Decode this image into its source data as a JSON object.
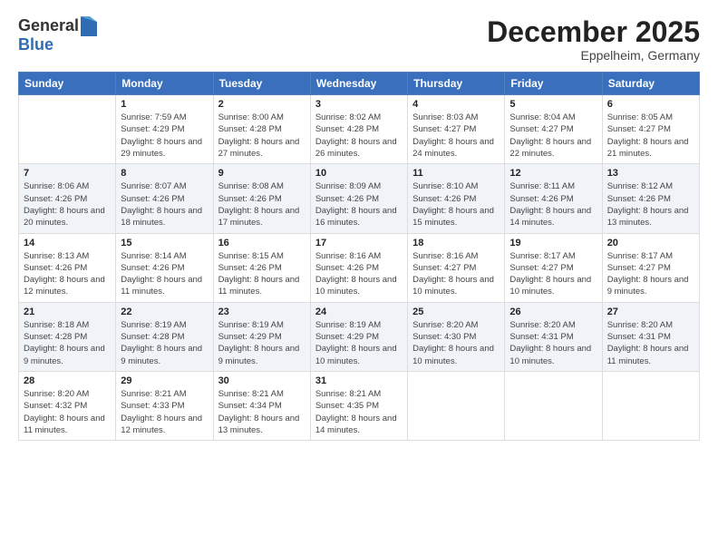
{
  "logo": {
    "general": "General",
    "blue": "Blue"
  },
  "header": {
    "month": "December 2025",
    "location": "Eppelheim, Germany"
  },
  "weekdays": [
    "Sunday",
    "Monday",
    "Tuesday",
    "Wednesday",
    "Thursday",
    "Friday",
    "Saturday"
  ],
  "weeks": [
    [
      {
        "day": "",
        "sunrise": "",
        "sunset": "",
        "daylight": ""
      },
      {
        "day": "1",
        "sunrise": "Sunrise: 7:59 AM",
        "sunset": "Sunset: 4:29 PM",
        "daylight": "Daylight: 8 hours and 29 minutes."
      },
      {
        "day": "2",
        "sunrise": "Sunrise: 8:00 AM",
        "sunset": "Sunset: 4:28 PM",
        "daylight": "Daylight: 8 hours and 27 minutes."
      },
      {
        "day": "3",
        "sunrise": "Sunrise: 8:02 AM",
        "sunset": "Sunset: 4:28 PM",
        "daylight": "Daylight: 8 hours and 26 minutes."
      },
      {
        "day": "4",
        "sunrise": "Sunrise: 8:03 AM",
        "sunset": "Sunset: 4:27 PM",
        "daylight": "Daylight: 8 hours and 24 minutes."
      },
      {
        "day": "5",
        "sunrise": "Sunrise: 8:04 AM",
        "sunset": "Sunset: 4:27 PM",
        "daylight": "Daylight: 8 hours and 22 minutes."
      },
      {
        "day": "6",
        "sunrise": "Sunrise: 8:05 AM",
        "sunset": "Sunset: 4:27 PM",
        "daylight": "Daylight: 8 hours and 21 minutes."
      }
    ],
    [
      {
        "day": "7",
        "sunrise": "Sunrise: 8:06 AM",
        "sunset": "Sunset: 4:26 PM",
        "daylight": "Daylight: 8 hours and 20 minutes."
      },
      {
        "day": "8",
        "sunrise": "Sunrise: 8:07 AM",
        "sunset": "Sunset: 4:26 PM",
        "daylight": "Daylight: 8 hours and 18 minutes."
      },
      {
        "day": "9",
        "sunrise": "Sunrise: 8:08 AM",
        "sunset": "Sunset: 4:26 PM",
        "daylight": "Daylight: 8 hours and 17 minutes."
      },
      {
        "day": "10",
        "sunrise": "Sunrise: 8:09 AM",
        "sunset": "Sunset: 4:26 PM",
        "daylight": "Daylight: 8 hours and 16 minutes."
      },
      {
        "day": "11",
        "sunrise": "Sunrise: 8:10 AM",
        "sunset": "Sunset: 4:26 PM",
        "daylight": "Daylight: 8 hours and 15 minutes."
      },
      {
        "day": "12",
        "sunrise": "Sunrise: 8:11 AM",
        "sunset": "Sunset: 4:26 PM",
        "daylight": "Daylight: 8 hours and 14 minutes."
      },
      {
        "day": "13",
        "sunrise": "Sunrise: 8:12 AM",
        "sunset": "Sunset: 4:26 PM",
        "daylight": "Daylight: 8 hours and 13 minutes."
      }
    ],
    [
      {
        "day": "14",
        "sunrise": "Sunrise: 8:13 AM",
        "sunset": "Sunset: 4:26 PM",
        "daylight": "Daylight: 8 hours and 12 minutes."
      },
      {
        "day": "15",
        "sunrise": "Sunrise: 8:14 AM",
        "sunset": "Sunset: 4:26 PM",
        "daylight": "Daylight: 8 hours and 11 minutes."
      },
      {
        "day": "16",
        "sunrise": "Sunrise: 8:15 AM",
        "sunset": "Sunset: 4:26 PM",
        "daylight": "Daylight: 8 hours and 11 minutes."
      },
      {
        "day": "17",
        "sunrise": "Sunrise: 8:16 AM",
        "sunset": "Sunset: 4:26 PM",
        "daylight": "Daylight: 8 hours and 10 minutes."
      },
      {
        "day": "18",
        "sunrise": "Sunrise: 8:16 AM",
        "sunset": "Sunset: 4:27 PM",
        "daylight": "Daylight: 8 hours and 10 minutes."
      },
      {
        "day": "19",
        "sunrise": "Sunrise: 8:17 AM",
        "sunset": "Sunset: 4:27 PM",
        "daylight": "Daylight: 8 hours and 10 minutes."
      },
      {
        "day": "20",
        "sunrise": "Sunrise: 8:17 AM",
        "sunset": "Sunset: 4:27 PM",
        "daylight": "Daylight: 8 hours and 9 minutes."
      }
    ],
    [
      {
        "day": "21",
        "sunrise": "Sunrise: 8:18 AM",
        "sunset": "Sunset: 4:28 PM",
        "daylight": "Daylight: 8 hours and 9 minutes."
      },
      {
        "day": "22",
        "sunrise": "Sunrise: 8:19 AM",
        "sunset": "Sunset: 4:28 PM",
        "daylight": "Daylight: 8 hours and 9 minutes."
      },
      {
        "day": "23",
        "sunrise": "Sunrise: 8:19 AM",
        "sunset": "Sunset: 4:29 PM",
        "daylight": "Daylight: 8 hours and 9 minutes."
      },
      {
        "day": "24",
        "sunrise": "Sunrise: 8:19 AM",
        "sunset": "Sunset: 4:29 PM",
        "daylight": "Daylight: 8 hours and 10 minutes."
      },
      {
        "day": "25",
        "sunrise": "Sunrise: 8:20 AM",
        "sunset": "Sunset: 4:30 PM",
        "daylight": "Daylight: 8 hours and 10 minutes."
      },
      {
        "day": "26",
        "sunrise": "Sunrise: 8:20 AM",
        "sunset": "Sunset: 4:31 PM",
        "daylight": "Daylight: 8 hours and 10 minutes."
      },
      {
        "day": "27",
        "sunrise": "Sunrise: 8:20 AM",
        "sunset": "Sunset: 4:31 PM",
        "daylight": "Daylight: 8 hours and 11 minutes."
      }
    ],
    [
      {
        "day": "28",
        "sunrise": "Sunrise: 8:20 AM",
        "sunset": "Sunset: 4:32 PM",
        "daylight": "Daylight: 8 hours and 11 minutes."
      },
      {
        "day": "29",
        "sunrise": "Sunrise: 8:21 AM",
        "sunset": "Sunset: 4:33 PM",
        "daylight": "Daylight: 8 hours and 12 minutes."
      },
      {
        "day": "30",
        "sunrise": "Sunrise: 8:21 AM",
        "sunset": "Sunset: 4:34 PM",
        "daylight": "Daylight: 8 hours and 13 minutes."
      },
      {
        "day": "31",
        "sunrise": "Sunrise: 8:21 AM",
        "sunset": "Sunset: 4:35 PM",
        "daylight": "Daylight: 8 hours and 14 minutes."
      },
      {
        "day": "",
        "sunrise": "",
        "sunset": "",
        "daylight": ""
      },
      {
        "day": "",
        "sunrise": "",
        "sunset": "",
        "daylight": ""
      },
      {
        "day": "",
        "sunrise": "",
        "sunset": "",
        "daylight": ""
      }
    ]
  ]
}
